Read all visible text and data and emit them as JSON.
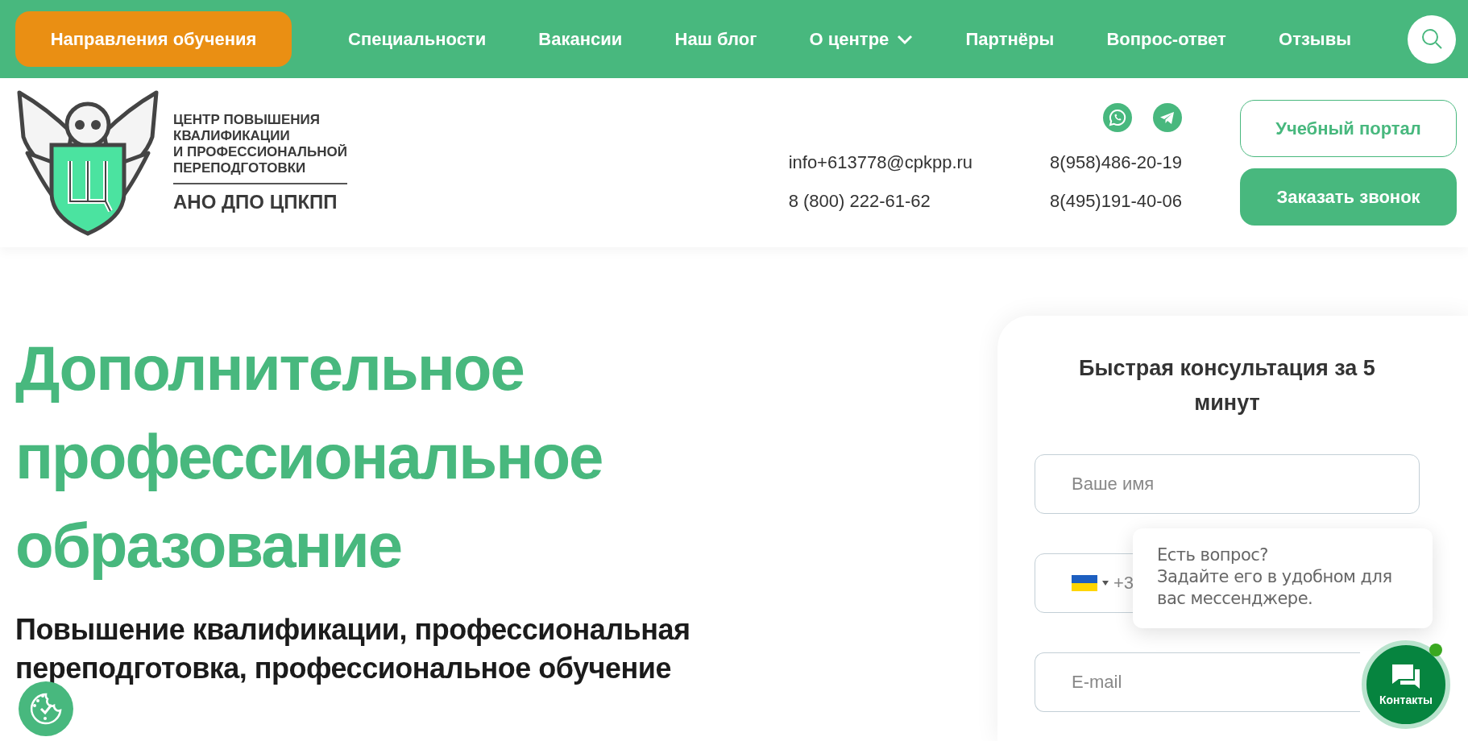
{
  "nav": {
    "cta": "Направления обучения",
    "items": [
      {
        "label": "Специальности",
        "dropdown": false
      },
      {
        "label": "Вакансии",
        "dropdown": false
      },
      {
        "label": "Наш блог",
        "dropdown": false
      },
      {
        "label": "О центре",
        "dropdown": true
      },
      {
        "label": "Партнёры",
        "dropdown": false
      },
      {
        "label": "Вопрос-ответ",
        "dropdown": false
      },
      {
        "label": "Отзывы",
        "dropdown": false
      }
    ]
  },
  "header": {
    "logo": {
      "lines": [
        "ЦЕНТР ПОВЫШЕНИЯ",
        "КВАЛИФИКАЦИИ",
        "И ПРОФЕССИОНАЛЬНОЙ",
        "ПЕРЕПОДГОТОВКИ"
      ],
      "short": "АНО ДПО ЦПКПП"
    },
    "contacts": [
      [
        "info+613778@cpkpp.ru",
        "8 (800) 222-61-62"
      ],
      [
        "8(958)486-20-19",
        "8(495)191-40-06"
      ]
    ],
    "buttons": [
      {
        "label": "Учебный портал",
        "kind": "outline"
      },
      {
        "label": "Заказать звонок",
        "kind": "filled"
      }
    ]
  },
  "hero": {
    "title": [
      "Дополнительное",
      "профессиональное",
      "образование"
    ],
    "subtitle": [
      "Повышение квалификации, профессиональная",
      "переподготовка, профессиональное обучение"
    ]
  },
  "form": {
    "title": "Быстрая консультация за 5 минут",
    "fields": [
      {
        "kind": "text",
        "placeholder": "Ваше имя"
      },
      {
        "kind": "phone",
        "prefix": "+3"
      },
      {
        "kind": "text",
        "placeholder": "E-mail"
      }
    ]
  },
  "chat": {
    "tooltip": [
      "Есть вопрос?",
      "Задайте его в удобном для",
      "вас мессенджере."
    ],
    "button": "Контакты",
    "online": true
  }
}
